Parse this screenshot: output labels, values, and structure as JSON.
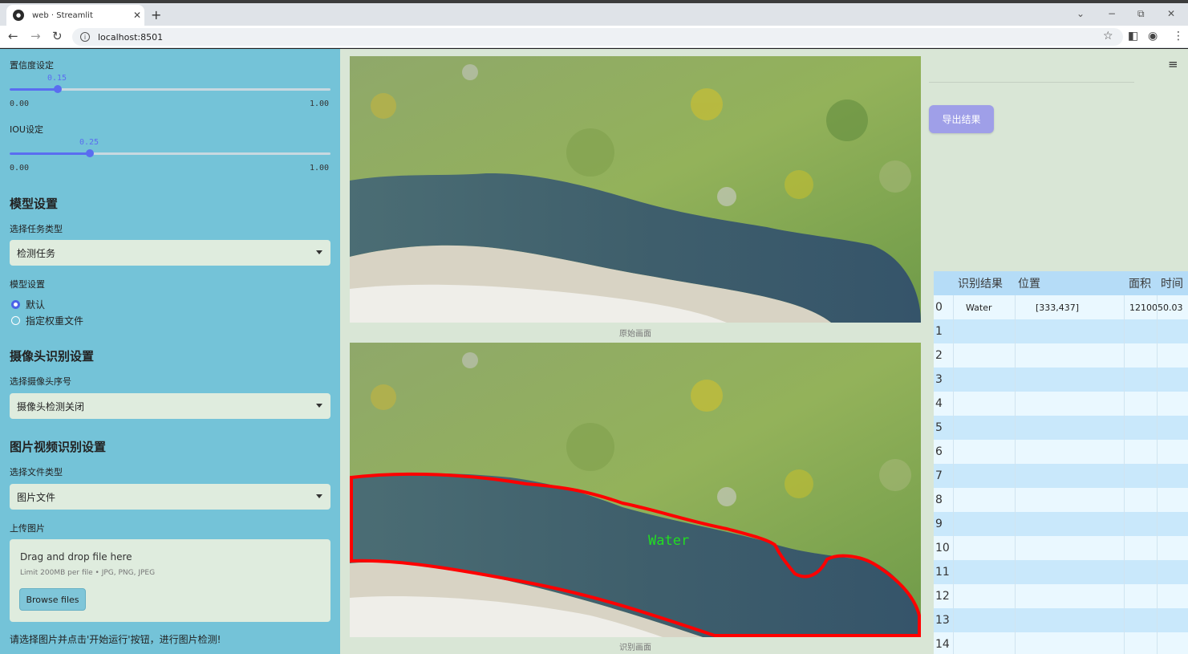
{
  "browser": {
    "tab_title": "web · Streamlit",
    "tab_close": "✕",
    "new_tab": "+",
    "url": "localhost:8501",
    "nav": {
      "back": "←",
      "forward": "→",
      "reload": "↻"
    },
    "window": {
      "chevron": "⌄",
      "minimize": "−",
      "restore": "⧉",
      "close": "✕"
    },
    "tools": {
      "star": "☆",
      "sidepanel": "◧",
      "profile": "◉",
      "menu": "⋮"
    }
  },
  "sidebar": {
    "conf_label": "置信度设定",
    "conf": {
      "value": "0.15",
      "min": "0.00",
      "max": "1.00",
      "fraction": 0.15
    },
    "iou_label": "IOU设定",
    "iou": {
      "value": "0.25",
      "min": "0.00",
      "max": "1.00",
      "fraction": 0.25
    },
    "model_heading": "模型设置",
    "task_label": "选择任务类型",
    "task_value": "检测任务",
    "model_label": "模型设置",
    "model_options": [
      "默认",
      "指定权重文件"
    ],
    "model_selected": 0,
    "camera_heading": "摄像头识别设置",
    "camera_label": "选择摄像头序号",
    "camera_value": "摄像头检测关闭",
    "media_heading": "图片视频识别设置",
    "filetype_label": "选择文件类型",
    "filetype_value": "图片文件",
    "upload_label": "上传图片",
    "upload_title": "Drag and drop file here",
    "upload_limit": "Limit 200MB per file • JPG, PNG, JPEG",
    "browse_label": "Browse files",
    "hint": "请选择图片并点击'开始运行'按钮，进行图片检测!"
  },
  "main": {
    "original_caption": "原始画面",
    "result_caption": "识别画面",
    "detection_label": "Water"
  },
  "right": {
    "menu_icon": "≡",
    "export_label": "导出结果",
    "table": {
      "columns": [
        "识别结果",
        "位置",
        "面积",
        "时间"
      ],
      "rows": [
        {
          "idx": "0",
          "result": "Water",
          "position": "[333,437]",
          "area": "1210050.03",
          "time": ""
        },
        {
          "idx": "1"
        },
        {
          "idx": "2"
        },
        {
          "idx": "3"
        },
        {
          "idx": "4"
        },
        {
          "idx": "5"
        },
        {
          "idx": "6"
        },
        {
          "idx": "7"
        },
        {
          "idx": "8"
        },
        {
          "idx": "9"
        },
        {
          "idx": "10"
        },
        {
          "idx": "11"
        },
        {
          "idx": "12"
        },
        {
          "idx": "13"
        },
        {
          "idx": "14"
        }
      ]
    }
  },
  "colors": {
    "sidebar": "#74c3d8",
    "accent": "#5a6df0",
    "detection": "#ff0000",
    "label_green": "#22dd22",
    "export_button": "#9f9fe8"
  }
}
